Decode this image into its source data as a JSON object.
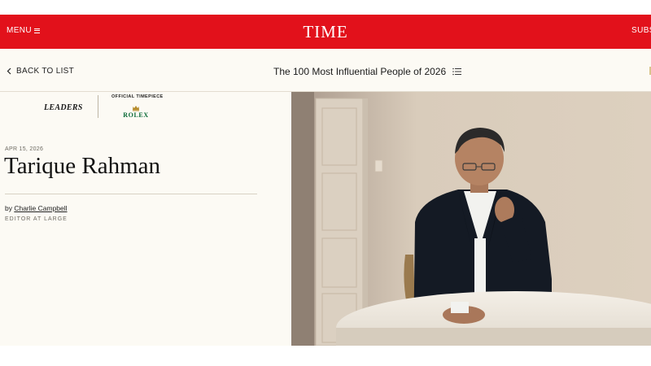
{
  "header": {
    "menu_label": "MENU",
    "logo_text": "TIME",
    "subscribe_label": "SUBS",
    "brand_color": "#e2111b"
  },
  "subnav": {
    "back_label": "BACK TO LIST",
    "list_title": "The 100 Most Influential People of 2026"
  },
  "sponsor": {
    "category": "LEADERS",
    "official_label": "OFFICIAL TIMEPIECE",
    "brand": "ROLEX",
    "brand_color": "#0a6a37"
  },
  "article": {
    "date": "APR 15, 2026",
    "headline": "Tarique Rahman",
    "by_prefix": "by ",
    "author": "Charlie Campbell",
    "author_role": "EDITOR AT LARGE"
  },
  "icons": {
    "menu": "hamburger-icon",
    "back": "chevron-left-icon",
    "list": "list-icon",
    "crown": "crown-icon"
  }
}
